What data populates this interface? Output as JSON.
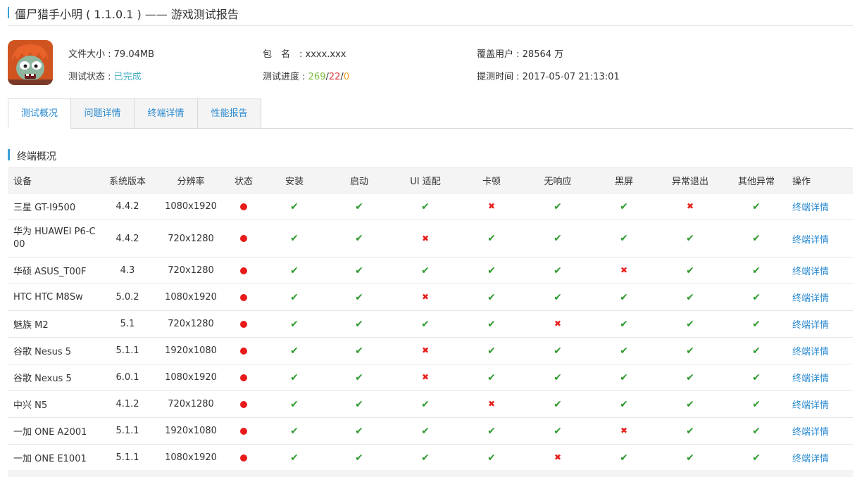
{
  "header": {
    "title": "僵尸猎手小明 ( 1.1.0.1 ) —— 游戏测试报告"
  },
  "info": {
    "file_size_label": "文件大小 : ",
    "file_size": "79.04MB",
    "status_label": "测试状态 : ",
    "status": "已完成",
    "package_label": "包　名　: ",
    "package": "xxxx.xxx",
    "progress_label": "测试进度 : ",
    "progress_pass": "269",
    "progress_sep1": "/",
    "progress_fail": "22",
    "progress_sep2": "/",
    "progress_pending": "0",
    "users_label": "覆盖用户 : ",
    "users": "28564 万",
    "submit_label": "提测时间 : ",
    "submit_time": "2017-05-07 21:13:01"
  },
  "tabs": [
    {
      "label": "测试概况",
      "active": true
    },
    {
      "label": "问题详情",
      "active": false
    },
    {
      "label": "终端详情",
      "active": false
    },
    {
      "label": "性能报告",
      "active": false
    }
  ],
  "section": {
    "title": "终端概况"
  },
  "table": {
    "headers": [
      "设备",
      "系统版本",
      "分辨率",
      "状态",
      "安装",
      "启动",
      "UI 适配",
      "卡顿",
      "无响应",
      "黑屏",
      "异常退出",
      "其他异常",
      "操作"
    ],
    "action_label": "终端详情",
    "rows": [
      {
        "device": "三星 GT-I9500",
        "os": "4.4.2",
        "res": "1080x1920",
        "checks": [
          1,
          1,
          1,
          0,
          1,
          1,
          0,
          1
        ]
      },
      {
        "device": "华为 HUAWEI P6-C00",
        "os": "4.4.2",
        "res": "720x1280",
        "checks": [
          1,
          1,
          0,
          1,
          1,
          1,
          1,
          1
        ]
      },
      {
        "device": "华硕 ASUS_T00F",
        "os": "4.3",
        "res": "720x1280",
        "checks": [
          1,
          1,
          1,
          1,
          1,
          0,
          1,
          1
        ]
      },
      {
        "device": "HTC HTC M8Sw",
        "os": "5.0.2",
        "res": "1080x1920",
        "checks": [
          1,
          1,
          0,
          1,
          1,
          1,
          1,
          1
        ]
      },
      {
        "device": "魅族 M2",
        "os": "5.1",
        "res": "720x1280",
        "checks": [
          1,
          1,
          1,
          1,
          0,
          1,
          1,
          1
        ]
      },
      {
        "device": "谷歌 Nesus 5",
        "os": "5.1.1",
        "res": "1920x1080",
        "checks": [
          1,
          1,
          0,
          1,
          1,
          1,
          1,
          1
        ]
      },
      {
        "device": "谷歌 Nexus 5",
        "os": "6.0.1",
        "res": "1080x1920",
        "checks": [
          1,
          1,
          0,
          1,
          1,
          1,
          1,
          1
        ]
      },
      {
        "device": "中兴 N5",
        "os": "4.1.2",
        "res": "720x1280",
        "checks": [
          1,
          1,
          1,
          0,
          1,
          1,
          1,
          1
        ]
      },
      {
        "device": "一加 ONE A2001",
        "os": "5.1.1",
        "res": "1920x1080",
        "checks": [
          1,
          1,
          1,
          1,
          1,
          0,
          1,
          1
        ]
      },
      {
        "device": "一加 ONE E1001",
        "os": "5.1.1",
        "res": "1080x1920",
        "checks": [
          1,
          1,
          1,
          1,
          0,
          1,
          1,
          1
        ]
      }
    ]
  },
  "icons": {
    "ok": "check-icon",
    "bad": "cross-icon",
    "status": "status-dot-icon"
  },
  "colors": {
    "accent": "#3b9fd8",
    "ok": "#2e9a2e",
    "bad": "#e8201c",
    "status_dot": "#e81a1a",
    "link": "#2a8ad0"
  }
}
